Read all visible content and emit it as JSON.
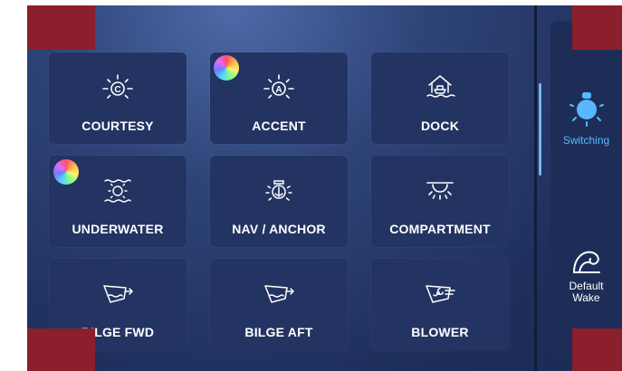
{
  "tiles": [
    {
      "label": "COURTESY",
      "icon": "bulb-c-icon"
    },
    {
      "label": "ACCENT",
      "icon": "bulb-a-icon",
      "rgb": true
    },
    {
      "label": "DOCK",
      "icon": "dock-house-icon"
    },
    {
      "label": "UNDERWATER",
      "icon": "underwater-light-icon",
      "rgb": true
    },
    {
      "label": "NAV / ANCHOR",
      "icon": "anchor-light-icon"
    },
    {
      "label": "COMPARTMENT",
      "icon": "compartment-light-icon"
    },
    {
      "label": "BILGE FWD",
      "icon": "bilge-fwd-icon"
    },
    {
      "label": "BILGE AFT",
      "icon": "bilge-aft-icon"
    },
    {
      "label": "BLOWER",
      "icon": "blower-fan-icon"
    }
  ],
  "sidebar": {
    "switching_label": "Switching",
    "wake_label_line1": "Default",
    "wake_label_line2": "Wake"
  },
  "colors": {
    "accent": "#6fb6ff",
    "tile": "#233462",
    "corner_marker": "#8b1f2c"
  }
}
